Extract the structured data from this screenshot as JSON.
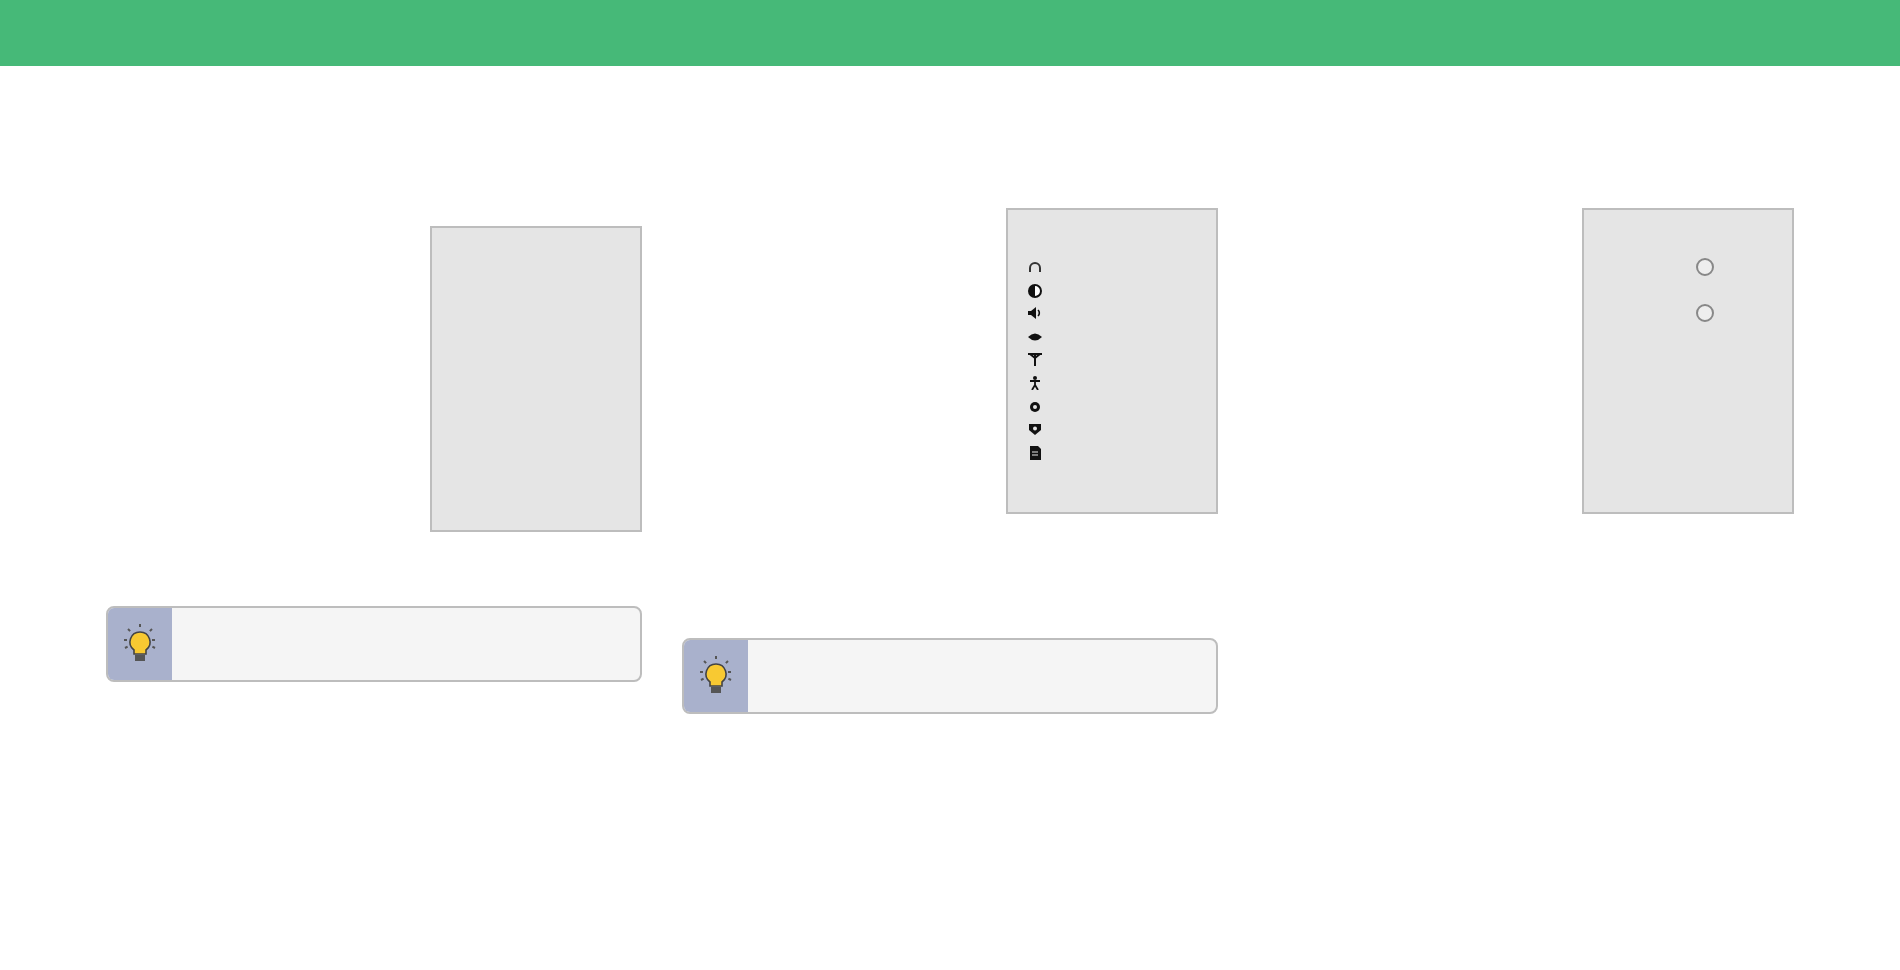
{
  "columns": [
    {
      "kind": "blank",
      "tip": true
    },
    {
      "kind": "icons",
      "tip": true
    },
    {
      "kind": "radios",
      "tip": false,
      "radios": [
        {
          "selected": false
        },
        {
          "selected": false
        }
      ]
    }
  ]
}
